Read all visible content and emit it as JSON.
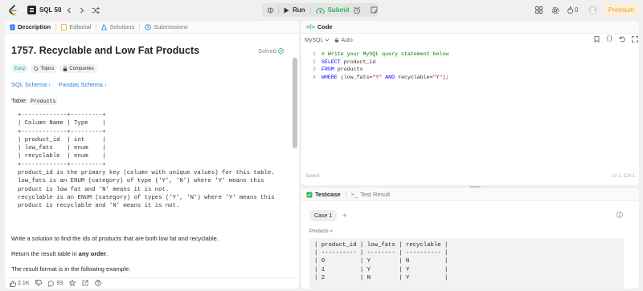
{
  "topbar": {
    "problem_list": "SQL 50",
    "run_label": "Run",
    "submit_label": "Submit",
    "streak_count": "0",
    "premium_label": "Premium"
  },
  "left_tabs": [
    {
      "label": "Description"
    },
    {
      "label": "Editorial"
    },
    {
      "label": "Solutions"
    },
    {
      "label": "Submissions"
    }
  ],
  "problem": {
    "title": "1757. Recyclable and Low Fat Products",
    "status": "Solved",
    "difficulty": "Easy",
    "topics_label": "Topics",
    "companies_label": "Companies",
    "schema_sql": "SQL Schema",
    "schema_pandas": "Pandas Schema",
    "table_label": "Table:",
    "table_name": "Products",
    "schema_text": "+-------------+---------+\n| Column Name | Type    |\n+-------------+---------+\n| product_id  | int     |\n| low_fats    | enum    |\n| recyclable  | enum    |\n+-------------+---------+\nproduct_id is the primary key (column with unique values) for this table.\nlow_fats is an ENUM (category) of type ('Y', 'N') where 'Y' means this\nproduct is low fat and 'N' means it is not.\nrecyclable is an ENUM (category) of types ('Y', 'N') where 'Y' means this\nproduct is recyclable and 'N' means it is not.",
    "task_text": "Write a solution to find the ids of products that are both low fat and recyclable.",
    "return_prefix": "Return the result table in ",
    "return_bold": "any order",
    "return_suffix": ".",
    "format_text": "The result format is in the following example."
  },
  "left_footer": {
    "likes": "2.1K",
    "comments": "93"
  },
  "code_panel": {
    "title": "Code",
    "language": "MySQL",
    "auto_label": "Auto",
    "lines": [
      {
        "num": "1",
        "type": "comment",
        "text": "# Write your MySQL query statement below"
      },
      {
        "num": "2",
        "type": "kw",
        "kw": "SELECT",
        "rest": " product_id"
      },
      {
        "num": "3",
        "type": "kw",
        "kw": "FROM",
        "rest": " products"
      },
      {
        "num": "4",
        "type": "where",
        "kw": "WHERE",
        "a": " (low_fats=",
        "s1": "\"Y\"",
        "and": " AND ",
        "b": "recyclable=",
        "s2": "\"Y\"",
        "end": ");"
      }
    ],
    "saved_label": "Saved",
    "cursor_pos": "Ln 1, Col 1"
  },
  "test_panel": {
    "tab_testcase": "Testcase",
    "tab_result": "Test Result",
    "case_label": "Case 1",
    "add_label": "+",
    "table_label": "Products =",
    "result_text": "| product_id | low_fats | recyclable |\n| ---------- | -------- | ---------- |\n| 0          | Y        | N          |\n| 1          | Y        | Y          |\n| 2          | N        | Y          |"
  },
  "colors": {
    "accent_green": "#2db55d",
    "easy": "#16a3a3",
    "link": "#2a7fd4",
    "premium": "#f0a020"
  }
}
